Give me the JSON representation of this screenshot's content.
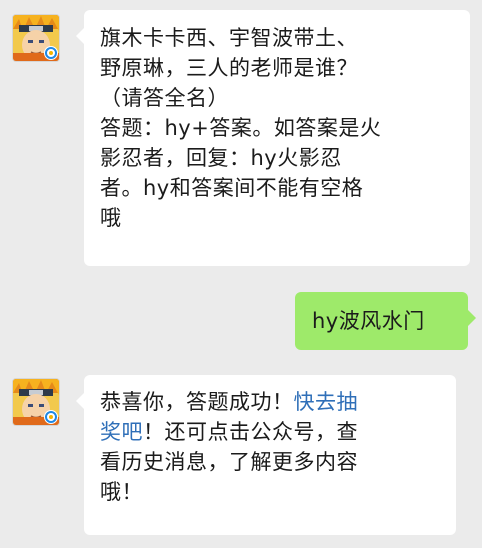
{
  "messages": [
    {
      "sender": "official-account",
      "lines": [
        "旗木卡卡西、宇智波带土、",
        "野原琳，三人的老师是谁？",
        "（请答全名）",
        "答题：hy+答案。如答案是火",
        "影忍者，回复：hy火影忍",
        "者。hy和答案间不能有空格",
        "哦"
      ]
    },
    {
      "sender": "me",
      "text": "hy波风水门"
    },
    {
      "sender": "official-account",
      "line1_before": "恭喜你，答题成功！",
      "line1_link": "快去抽",
      "line2_link": "奖吧",
      "line2_after": "！还可点击公众号，查",
      "line3": "看历史消息，了解更多内容",
      "line4": "哦！"
    }
  ],
  "colors": {
    "background": "#ebebeb",
    "incoming_bubble": "#ffffff",
    "outgoing_bubble": "#9eea6a",
    "link": "#2f6fb8"
  },
  "icons": {
    "avatar": "naruto-avatar-icon",
    "badge": "tencent-games-badge-icon"
  }
}
